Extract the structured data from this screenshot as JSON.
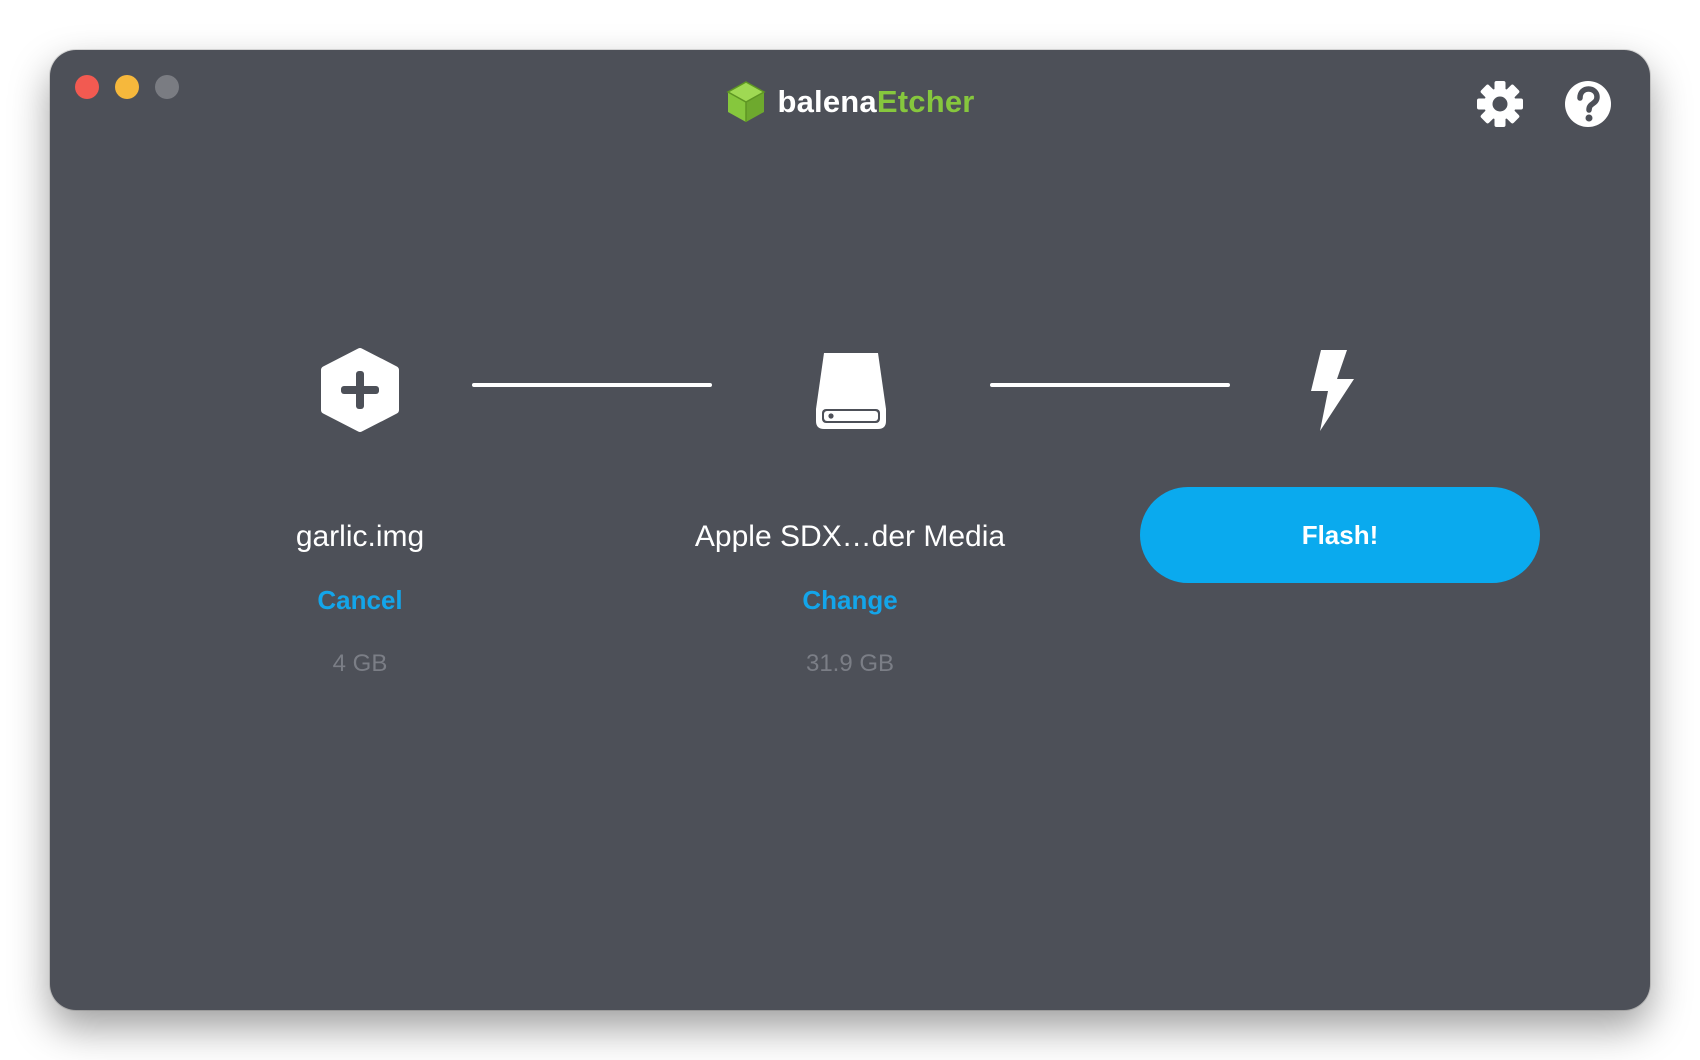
{
  "window": {
    "controls": [
      "close",
      "minimize",
      "maximize"
    ]
  },
  "header": {
    "logo_part1": "balena",
    "logo_part2": "Etcher",
    "logo_icon": "cube-icon",
    "settings_icon": "gear-icon",
    "help_icon": "question-icon"
  },
  "steps": {
    "image": {
      "icon": "plus-hexagon-icon",
      "name": "garlic.img",
      "action": "Cancel",
      "size": "4 GB"
    },
    "drive": {
      "icon": "drive-icon",
      "name": "Apple SDX…der Media",
      "action": "Change",
      "size": "31.9 GB"
    },
    "flash": {
      "icon": "lightning-icon",
      "button": "Flash!"
    }
  },
  "colors": {
    "window_bg": "#4d5058",
    "accent": "#0aaaee",
    "link": "#13a5ea",
    "brand_green": "#86c73d",
    "muted_text": "#7b7e86"
  }
}
